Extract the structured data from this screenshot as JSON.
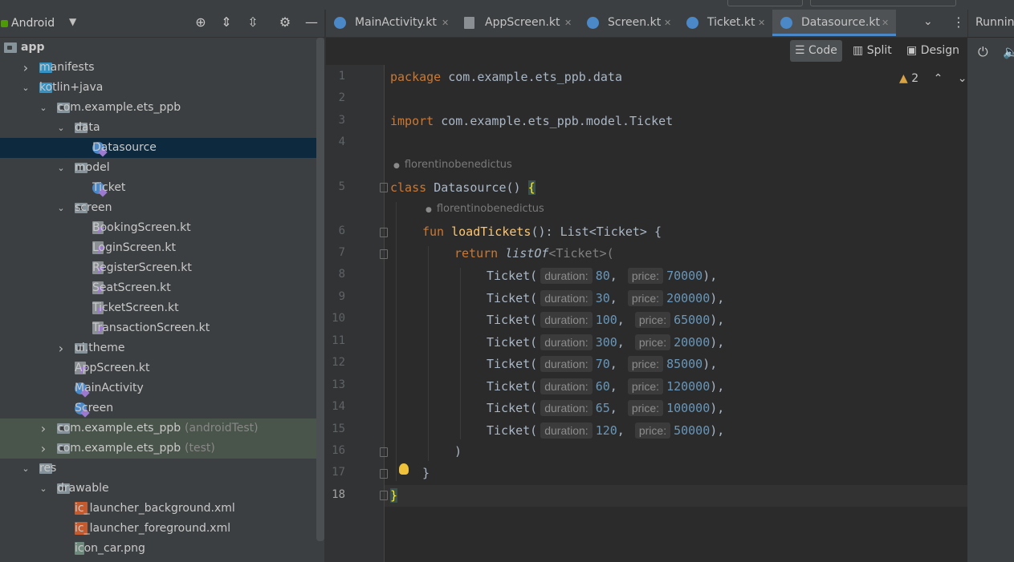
{
  "project_panel": {
    "view_selector": "Android",
    "tree": [
      {
        "label": "app",
        "level": 0,
        "arrow": "",
        "icon": "folder",
        "bold": true
      },
      {
        "label": "manifests",
        "level": 1,
        "arrow": "›",
        "icon": "blue-folder"
      },
      {
        "label": "kotlin+java",
        "level": 1,
        "arrow": "⌄",
        "icon": "blue-folder"
      },
      {
        "label": "com.example.ets_ppb",
        "level": 2,
        "arrow": "⌄",
        "icon": "folder"
      },
      {
        "label": "data",
        "level": 3,
        "arrow": "⌄",
        "icon": "folder"
      },
      {
        "label": "Datasource",
        "level": 4,
        "arrow": "",
        "icon": "kotlin-class",
        "selected": true
      },
      {
        "label": "model",
        "level": 3,
        "arrow": "⌄",
        "icon": "folder"
      },
      {
        "label": "Ticket",
        "level": 4,
        "arrow": "",
        "icon": "kotlin-class"
      },
      {
        "label": "screen",
        "level": 3,
        "arrow": "⌄",
        "icon": "folder"
      },
      {
        "label": "BookingScreen.kt",
        "level": 4,
        "arrow": "",
        "icon": "kotlin-file"
      },
      {
        "label": "LoginScreen.kt",
        "level": 4,
        "arrow": "",
        "icon": "kotlin-file"
      },
      {
        "label": "RegisterScreen.kt",
        "level": 4,
        "arrow": "",
        "icon": "kotlin-file"
      },
      {
        "label": "SeatScreen.kt",
        "level": 4,
        "arrow": "",
        "icon": "kotlin-file"
      },
      {
        "label": "TicketScreen.kt",
        "level": 4,
        "arrow": "",
        "icon": "kotlin-file"
      },
      {
        "label": "TransactionScreen.kt",
        "level": 4,
        "arrow": "",
        "icon": "kotlin-file"
      },
      {
        "label": "ui.theme",
        "level": 3,
        "arrow": "›",
        "icon": "folder"
      },
      {
        "label": "AppScreen.kt",
        "level": 3,
        "arrow": "",
        "icon": "kotlin-file"
      },
      {
        "label": "MainActivity",
        "level": 3,
        "arrow": "",
        "icon": "kotlin-class"
      },
      {
        "label": "Screen",
        "level": 3,
        "arrow": "",
        "icon": "kotlin-class"
      },
      {
        "label": "com.example.ets_ppb",
        "suffix": "(androidTest)",
        "level": 2,
        "arrow": "›",
        "icon": "folder",
        "test": true
      },
      {
        "label": "com.example.ets_ppb",
        "suffix": "(test)",
        "level": 2,
        "arrow": "›",
        "icon": "folder",
        "test": true
      },
      {
        "label": "res",
        "level": 1,
        "arrow": "⌄",
        "icon": "res-folder"
      },
      {
        "label": "drawable",
        "level": 2,
        "arrow": "⌄",
        "icon": "folder"
      },
      {
        "label": "ic_launcher_background.xml",
        "level": 3,
        "arrow": "",
        "icon": "xml-file"
      },
      {
        "label": "ic_launcher_foreground.xml",
        "level": 3,
        "arrow": "",
        "icon": "xml-file"
      },
      {
        "label": "icon_car.png",
        "level": 3,
        "arrow": "",
        "icon": "png-file"
      }
    ]
  },
  "tabs": [
    {
      "label": "MainActivity.kt",
      "icon": "kotlin-class"
    },
    {
      "label": "AppScreen.kt",
      "icon": "kotlin-file"
    },
    {
      "label": "Screen.kt",
      "icon": "kotlin-class"
    },
    {
      "label": "Ticket.kt",
      "icon": "kotlin-class"
    },
    {
      "label": "Datasource.kt",
      "icon": "kotlin-class",
      "active": true
    }
  ],
  "run_widget": "Running",
  "editor_modes": {
    "code": "Code",
    "split": "Split",
    "design": "Design"
  },
  "inspections": {
    "warnings": "2"
  },
  "code": {
    "author": "florentinobenedictus",
    "package_kw": "package",
    "package_name": "com.example.ets_ppb.data",
    "import_kw": "import",
    "import_name": "com.example.ets_ppb.model.Ticket",
    "class_kw": "class",
    "class_name": "Datasource",
    "fun_kw": "fun",
    "fun_name": "loadTickets",
    "fun_return": "(): List<Ticket> {",
    "return_kw": "return",
    "list_of": "listOf",
    "list_generic": "<Ticket>(",
    "ticket_ctor": "Ticket(",
    "duration_hint": "duration:",
    "price_hint": "price:",
    "tickets": [
      {
        "duration": "80",
        "price": "70000"
      },
      {
        "duration": "30",
        "price": "200000"
      },
      {
        "duration": "100",
        "price": "65000"
      },
      {
        "duration": "300",
        "price": "20000"
      },
      {
        "duration": "70",
        "price": "85000"
      },
      {
        "duration": "60",
        "price": "120000"
      },
      {
        "duration": "65",
        "price": "100000"
      },
      {
        "duration": "120",
        "price": "50000"
      }
    ],
    "close_paren": ")",
    "close_brace": "}"
  },
  "line_numbers": [
    "1",
    "2",
    "3",
    "4",
    "5",
    "6",
    "7",
    "8",
    "9",
    "10",
    "11",
    "12",
    "13",
    "14",
    "15",
    "16",
    "17",
    "18"
  ],
  "colors": {
    "keyword": "#cc7832",
    "function": "#ffc66d",
    "number": "#6897bb",
    "selection": "#0d293e",
    "accent": "#4a88c7"
  }
}
